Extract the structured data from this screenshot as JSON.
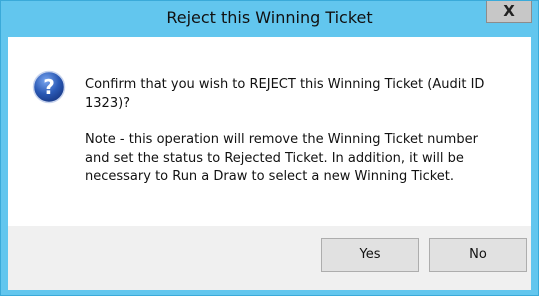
{
  "dialog": {
    "title": "Reject this Winning Ticket",
    "close_symbol": "X",
    "icon": "question-icon",
    "confirm_text": "Confirm that you wish to REJECT this Winning Ticket (Audit ID 1323)?",
    "note_text": "Note - this operation will remove the Winning Ticket number and set the status to Rejected Ticket. In addition, it will be necessary to Run a Draw to select a new Winning Ticket.",
    "buttons": {
      "yes_label": "Yes",
      "no_label": "No"
    }
  },
  "colors": {
    "frame": "#62c6ee",
    "icon_blue": "#2a59b5"
  }
}
